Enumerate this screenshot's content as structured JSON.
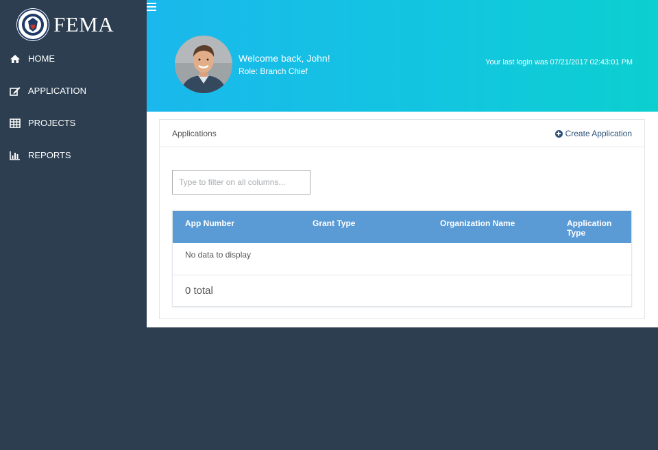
{
  "brand": {
    "name": "FEMA",
    "logo": "dhs-seal-icon"
  },
  "sidebar": {
    "items": [
      {
        "label": "HOME",
        "icon": "home-icon"
      },
      {
        "label": "APPLICATION",
        "icon": "edit-icon"
      },
      {
        "label": "PROJECTS",
        "icon": "table-icon"
      },
      {
        "label": "REPORTS",
        "icon": "bar-chart-icon"
      }
    ]
  },
  "header": {
    "menu_icon": "hamburger-icon",
    "welcome": "Welcome back, John!",
    "role": "Role: Branch Chief",
    "last_login": "Your last login was 07/21/2017 02:43:01 PM"
  },
  "applications": {
    "title": "Applications",
    "create_label": "Create Application",
    "filter_placeholder": "Type to filter on all columns...",
    "columns": [
      "App Number",
      "Grant Type",
      "Organization Name",
      "Application Type"
    ],
    "empty_message": "No data to display",
    "total": "0 total"
  },
  "colors": {
    "sidebar_bg": "#2c3e50",
    "header_gradient_start": "#1ab8ec",
    "header_gradient_end": "#0ccfcf",
    "grid_header": "#5b9bd5",
    "link": "#2b5079"
  }
}
